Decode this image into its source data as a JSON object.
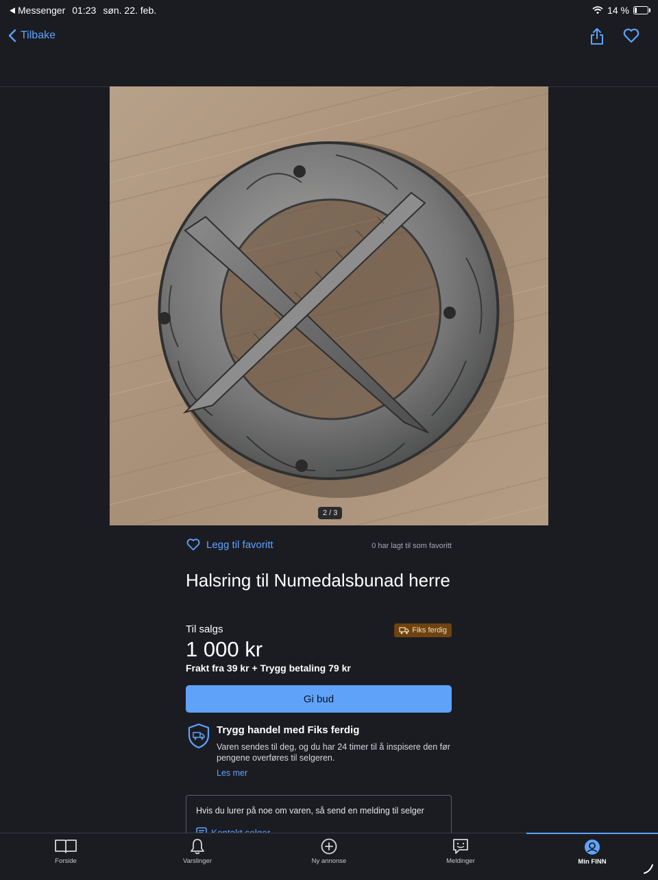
{
  "status_bar": {
    "back_app": "Messenger",
    "time": "01:23",
    "date": "søn. 22. feb.",
    "battery": "14 %"
  },
  "nav": {
    "back_label": "Tilbake"
  },
  "photo": {
    "counter": "2 / 3"
  },
  "favorite": {
    "label": "Legg til favoritt",
    "count_text": "0 har lagt til som favoritt"
  },
  "listing": {
    "title": "Halsring til Numedalsbunad herre",
    "status": "Til salgs",
    "badge": "Fiks ferdig",
    "price": "1 000 kr",
    "shipping": "Frakt fra 39 kr + Trygg betaling 79 kr",
    "bid_button": "Gi bud"
  },
  "safe_trade": {
    "title": "Trygg handel med Fiks ferdig",
    "description": "Varen sendes til deg, og du har 24 timer til å inspisere den før pengene overføres til selgeren.",
    "link": "Les mer"
  },
  "contact": {
    "text": "Hvis du lurer på noe om varen, så send en melding til selger",
    "link": "Kontakt selger"
  },
  "tabs": [
    {
      "label": "Forside",
      "icon": "book-icon"
    },
    {
      "label": "Varslinger",
      "icon": "bell-icon"
    },
    {
      "label": "Ny annonse",
      "icon": "plus-circle-icon"
    },
    {
      "label": "Meldinger",
      "icon": "chat-icon"
    },
    {
      "label": "Min FINN",
      "icon": "profile-icon",
      "active": true
    }
  ],
  "colors": {
    "background": "#1b1c22",
    "accent": "#5ea4ff",
    "button": "#5fa2f9",
    "badge": "#6e4311"
  }
}
